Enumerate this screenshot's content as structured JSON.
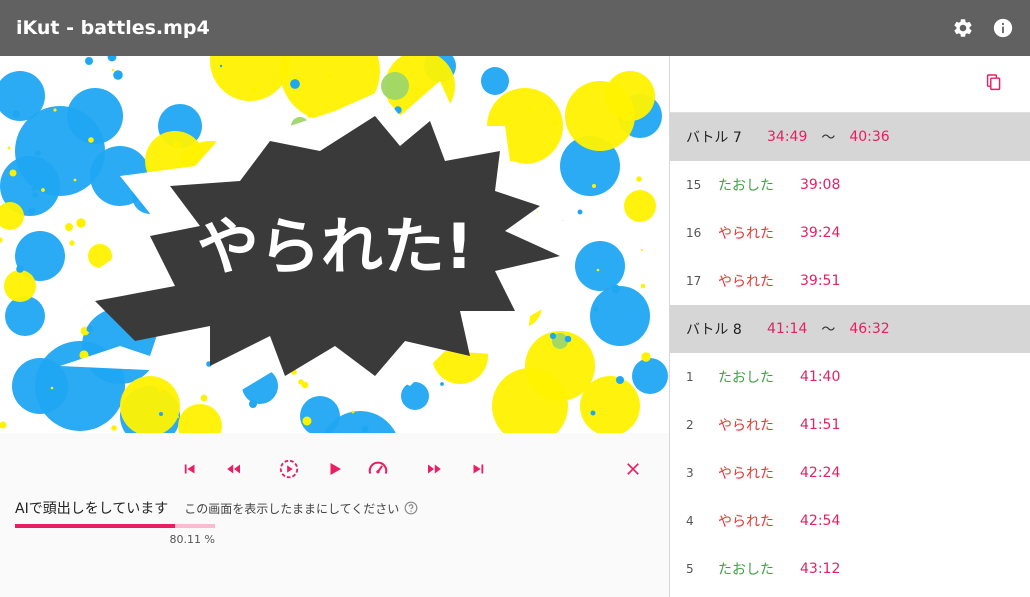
{
  "app": {
    "title": "iKut - battles.mp4"
  },
  "header": {
    "settings_icon": "gear-icon",
    "info_icon": "info-icon"
  },
  "video": {
    "caption": "やられた!"
  },
  "controls": [
    {
      "name": "skip-previous-button",
      "icon": "skip-previous-icon"
    },
    {
      "name": "rewind-button",
      "icon": "rewind-icon"
    },
    {
      "name": "replay-play-button",
      "icon": "replay-play-icon"
    },
    {
      "name": "play-button",
      "icon": "play-icon"
    },
    {
      "name": "speed-button",
      "icon": "speedometer-icon"
    },
    {
      "name": "fast-forward-button",
      "icon": "fast-forward-icon"
    },
    {
      "name": "skip-next-button",
      "icon": "skip-next-icon"
    },
    {
      "name": "close-button",
      "icon": "close-icon"
    }
  ],
  "status": {
    "main": "AIで頭出しをしています",
    "note": "この画面を表示したままにしてください",
    "progress": 0.8011,
    "percent_text": "80.11 %"
  },
  "colors": {
    "accent": "#e91e63",
    "kill": "#43a047",
    "death": "#e53935",
    "appbar": "#616161"
  },
  "battles": [
    {
      "name": "バトル 7",
      "start": "34:49",
      "tilde": "〜",
      "end": "40:36",
      "events": [
        {
          "num": "15",
          "kind": "たおした",
          "type": "kill",
          "time": "39:08"
        },
        {
          "num": "16",
          "kind": "やられた",
          "type": "death",
          "time": "39:24"
        },
        {
          "num": "17",
          "kind": "やられた",
          "type": "death",
          "time": "39:51"
        }
      ]
    },
    {
      "name": "バトル 8",
      "start": "41:14",
      "tilde": "〜",
      "end": "46:32",
      "events": [
        {
          "num": "1",
          "kind": "たおした",
          "type": "kill",
          "time": "41:40"
        },
        {
          "num": "2",
          "kind": "やられた",
          "type": "death",
          "time": "41:51"
        },
        {
          "num": "3",
          "kind": "やられた",
          "type": "death",
          "time": "42:24"
        },
        {
          "num": "4",
          "kind": "やられた",
          "type": "death",
          "time": "42:54"
        },
        {
          "num": "5",
          "kind": "たおした",
          "type": "kill",
          "time": "43:12"
        }
      ]
    }
  ]
}
